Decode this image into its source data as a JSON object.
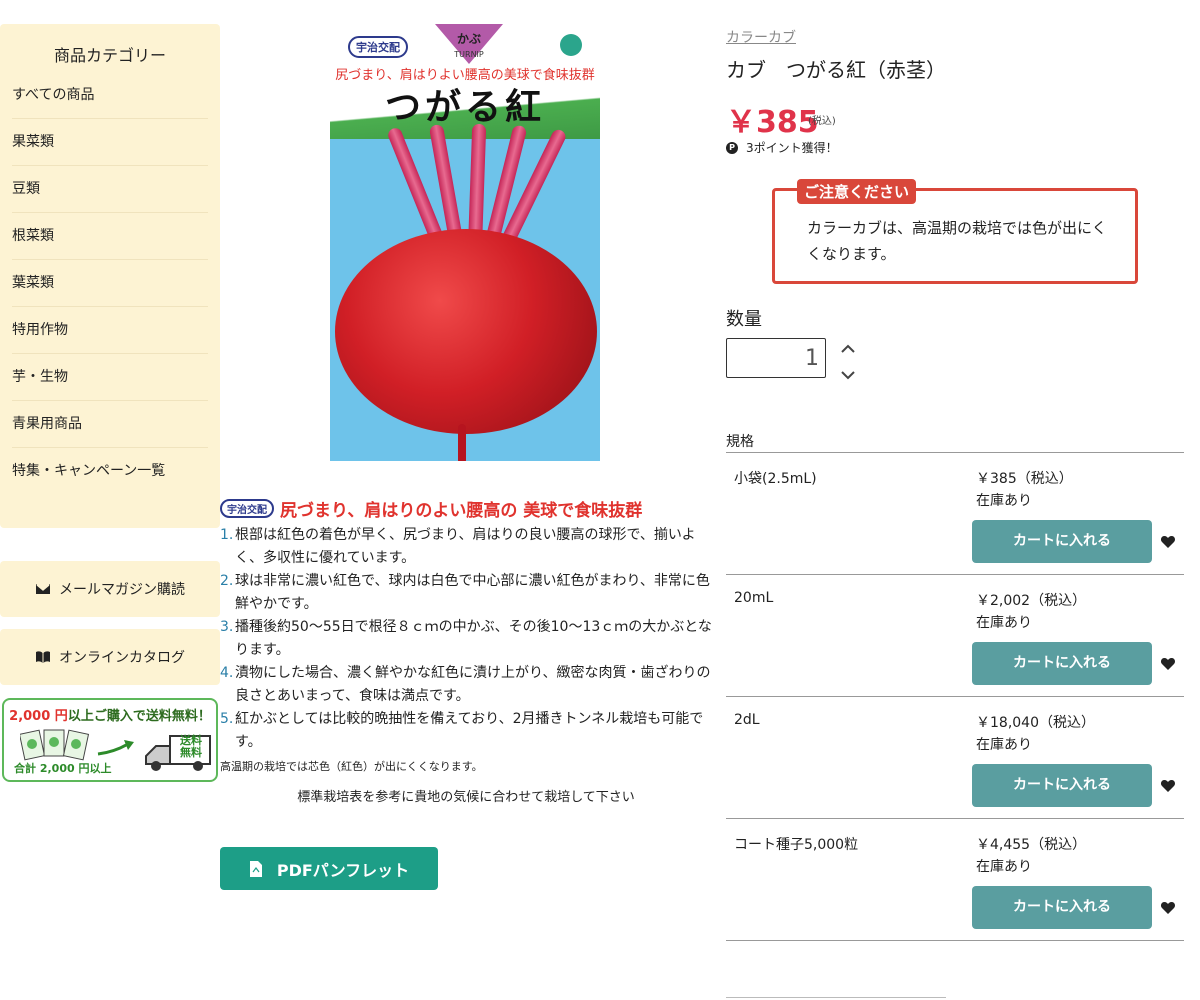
{
  "sidebar": {
    "title": "商品カテゴリー",
    "items": [
      {
        "label": "すべての商品"
      },
      {
        "label": "果菜類"
      },
      {
        "label": "豆類"
      },
      {
        "label": "根菜類"
      },
      {
        "label": "葉菜類"
      },
      {
        "label": "特用作物"
      },
      {
        "label": "芋・生物"
      },
      {
        "label": "青果用商品"
      },
      {
        "label": "特集・キャンペーン一覧"
      }
    ],
    "newsletter_label": "メールマガジン購読",
    "newsletter_icon": "envelope-icon",
    "catalog_label": "オンラインカタログ",
    "catalog_icon": "book-icon",
    "shipping_banner": {
      "amount": "2,000 円",
      "text": "以上ご購入で送料無料！",
      "bottom_text": "合計 2,000 円以上",
      "free_text": "送料無料"
    }
  },
  "package": {
    "badge": "宇治交配",
    "type": "かぶ",
    "type_en": "TURNIP",
    "subtitle": "尻づまり、肩はりよい腰高の美球で食味抜群",
    "name": "つがる紅"
  },
  "description": {
    "badge": "宇治交配",
    "title": "尻づまり、肩はりのよい腰高の 美球で食味抜群",
    "points": [
      {
        "num": "1.",
        "text": "根部は紅色の着色が早く、尻づまり、肩はりの良い腰高の球形で、揃いよく、多収性に優れています。"
      },
      {
        "num": "2.",
        "text": "球は非常に濃い紅色で、球内は白色で中心部に濃い紅色がまわり、非常に色鮮やかです。"
      },
      {
        "num": "3.",
        "text": "播種後約50〜55日で根径８ｃｍの中かぶ、その後10〜13ｃｍの大かぶとなります。"
      },
      {
        "num": "4.",
        "text": "漬物にした場合、濃く鮮やかな紅色に漬け上がり、緻密な肉質・歯ざわりの良さとあいまって、食味は満点です。"
      },
      {
        "num": "5.",
        "text": "紅かぶとしては比較的晩抽性を備えており、2月播きトンネル栽培も可能です。"
      }
    ],
    "note": "高温期の栽培では芯色（紅色）が出にくくなります。",
    "guide": "標準栽培表を参考に貴地の気候に合わせて栽培して下さい",
    "pdf_label": "PDFパンフレット"
  },
  "product": {
    "category": "カラーカブ",
    "title": "カブ　つがる紅（赤茎）",
    "price": "￥385",
    "tax_label": "(税込)",
    "points_icon": "P",
    "points": "3ポイント獲得！",
    "notice_label": "ご注意ください",
    "notice_text": "カラーカブは、高温期の栽培では色が出にくくなります。",
    "qty_label": "数量",
    "qty_value": "1",
    "spec_label": "規格",
    "cart_label": "カートに入れる",
    "specs": [
      {
        "name": "小袋(2.5mL)",
        "price": "￥385（税込）",
        "stock": "在庫あり"
      },
      {
        "name": "20mL",
        "price": "￥2,002（税込）",
        "stock": "在庫あり"
      },
      {
        "name": "2dL",
        "price": "￥18,040（税込）",
        "stock": "在庫あり"
      },
      {
        "name": "コート種子5,000粒",
        "price": "￥4,455（税込）",
        "stock": "在庫あり"
      }
    ]
  },
  "colors": {
    "sidebar_bg": "#fdf3d3",
    "price": "#e0334a",
    "notice": "#d9473a",
    "cart_button": "#5a9ea0",
    "pdf_button": "#1d9e87"
  }
}
